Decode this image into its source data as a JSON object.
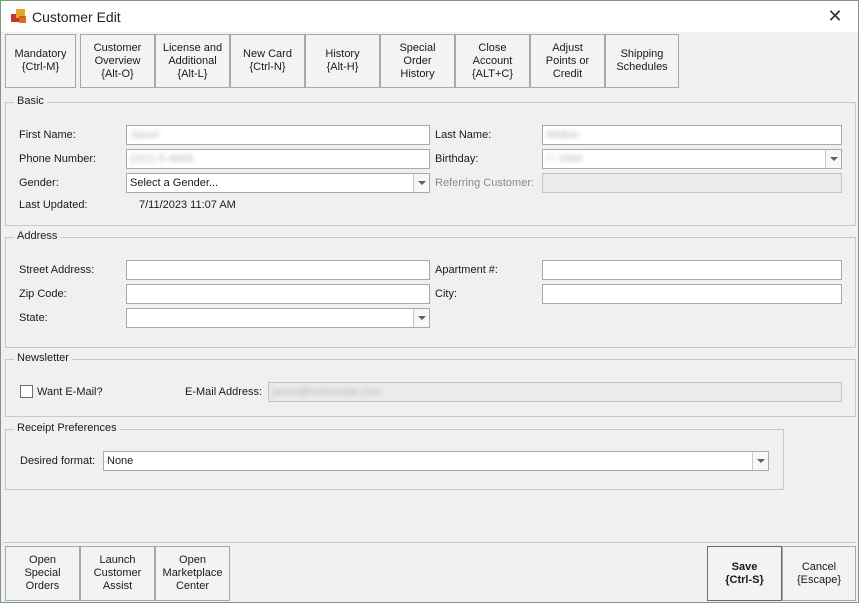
{
  "window": {
    "title": "Customer Edit",
    "close_glyph": "✕"
  },
  "toolbar": [
    {
      "label": "Mandatory\n{Ctrl-M}"
    },
    {
      "label": "Customer\nOverview\n{Alt-O}"
    },
    {
      "label": "License and\nAdditional\n{Alt-L}"
    },
    {
      "label": "New Card\n{Ctrl-N}"
    },
    {
      "label": "History\n{Alt-H}"
    },
    {
      "label": "Special\nOrder\nHistory"
    },
    {
      "label": "Close\nAccount\n{ALT+C}"
    },
    {
      "label": "Adjust\nPoints or\nCredit"
    },
    {
      "label": "Shipping\nSchedules"
    }
  ],
  "basic": {
    "group_label": "Basic",
    "first_name_label": "First Name:",
    "first_name_value": "Jason",
    "last_name_label": "Last Name:",
    "last_name_value": "Walker",
    "phone_label": "Phone Number:",
    "phone_value": "(321) 5-4868",
    "birthday_label": "Birthday:",
    "birthday_value": "/ / 1984",
    "gender_label": "Gender:",
    "gender_value": "Select a Gender...",
    "referring_label": "Referring Customer:",
    "last_updated_label": "Last Updated:",
    "last_updated_value": "7/11/2023 11:07 AM"
  },
  "address": {
    "group_label": "Address",
    "street_label": "Street Address:",
    "apartment_label": "Apartment #:",
    "zip_label": "Zip Code:",
    "city_label": "City:",
    "state_label": "State:"
  },
  "newsletter": {
    "group_label": "Newsletter",
    "want_email_label": "Want E-Mail?",
    "email_label": "E-Mail Address:",
    "email_value": "jason@hotmmale.com"
  },
  "receipt": {
    "group_label": "Receipt Preferences",
    "format_label": "Desired format:",
    "format_value": "None"
  },
  "bottom": {
    "open_special_orders": "Open\nSpecial\nOrders",
    "launch_customer_assist": "Launch\nCustomer\nAssist",
    "open_marketplace_center": "Open\nMarketplace\nCenter",
    "save": "Save\n{Ctrl-S}",
    "cancel": "Cancel\n{Escape}"
  }
}
